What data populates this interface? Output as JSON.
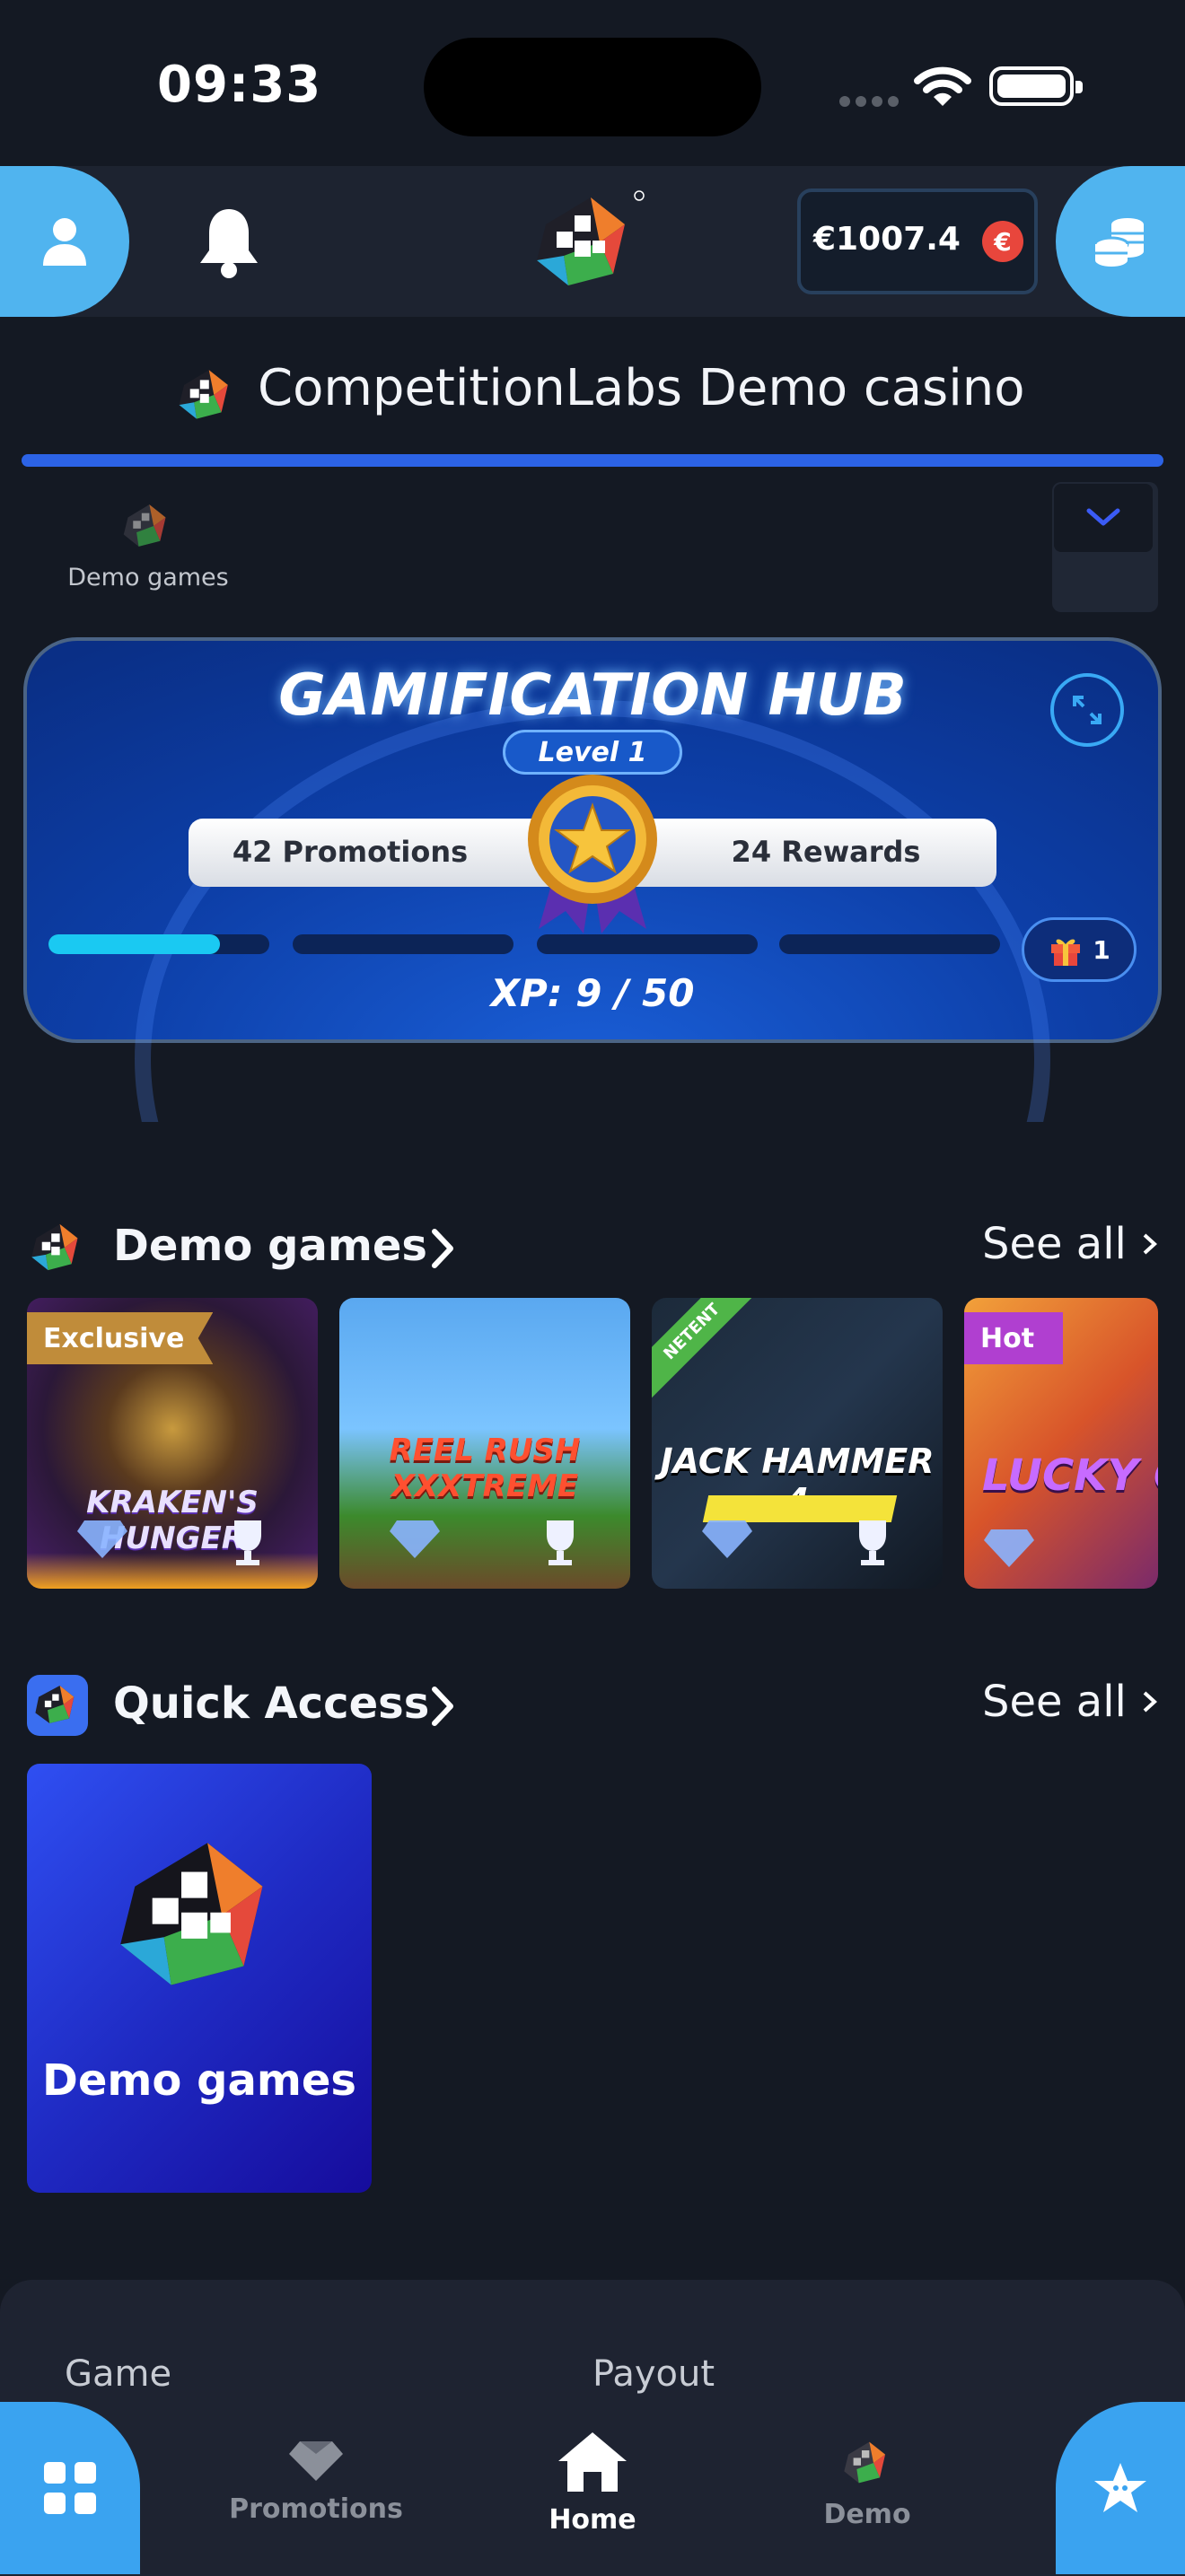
{
  "status_bar": {
    "time": "09:33"
  },
  "header": {
    "balance": "€1007.4",
    "currency_symbol": "€"
  },
  "site": {
    "title": "CompetitionLabs Demo casino"
  },
  "categories": {
    "selected_label": "Demo games"
  },
  "hub": {
    "title": "GAMIFICATION HUB",
    "level": "Level 1",
    "promotions": "42 Promotions",
    "rewards": "24 Rewards",
    "xp_text": "XP: 9 / 50",
    "xp_progress_fraction": 0.18,
    "gift_count": "1"
  },
  "demo_games": {
    "title": "Demo games",
    "see_all": "See all",
    "tiles": [
      {
        "badge": "Exclusive",
        "game_title": "KRAKEN'S HUNGER"
      },
      {
        "badge": "",
        "game_title": "REEL RUSH XXXTREME"
      },
      {
        "badge": "NETENT",
        "game_title": "JACK HAMMER 4"
      },
      {
        "badge": "Hot",
        "game_title": "LUCKY CREW"
      }
    ]
  },
  "quick_access": {
    "title": "Quick Access",
    "see_all": "See all",
    "card_label": "Demo games"
  },
  "table": {
    "col_game": "Game",
    "col_payout": "Payout"
  },
  "nav": {
    "promotions": "Promotions",
    "home": "Home",
    "demo": "Demo"
  },
  "colors": {
    "accent": "#50b4ef",
    "bar": "#2c63e6",
    "xp": "#1ac9f2",
    "background": "#141923"
  }
}
